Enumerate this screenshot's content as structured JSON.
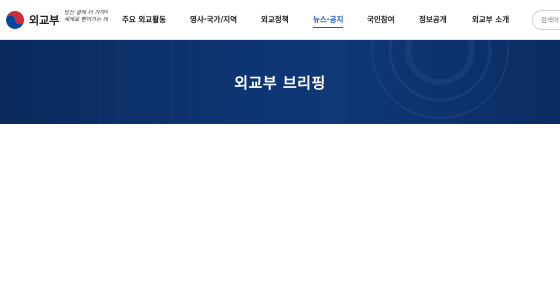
{
  "header": {
    "ministry_name": "외교부",
    "slogan_line1": "당신 곁에 더 가까이",
    "slogan_line2": "세계로 뻗어가는 대한민국",
    "nav": [
      {
        "label": "주요 외교활동",
        "active": false
      },
      {
        "label": "영사·국가/지역",
        "active": false
      },
      {
        "label": "외교정책",
        "active": false
      },
      {
        "label": "뉴스·공지",
        "active": true
      },
      {
        "label": "국민참여",
        "active": false
      },
      {
        "label": "정보공개",
        "active": false
      },
      {
        "label": "외교부 소개",
        "active": false
      }
    ],
    "search_placeholder": "검색어"
  },
  "banner": {
    "title": "외교부 브리핑"
  },
  "colors": {
    "banner_bg": "#0e3573",
    "active_nav": "#1c55b8",
    "emblem_red": "#cd2e3a",
    "emblem_blue": "#0047a0"
  }
}
